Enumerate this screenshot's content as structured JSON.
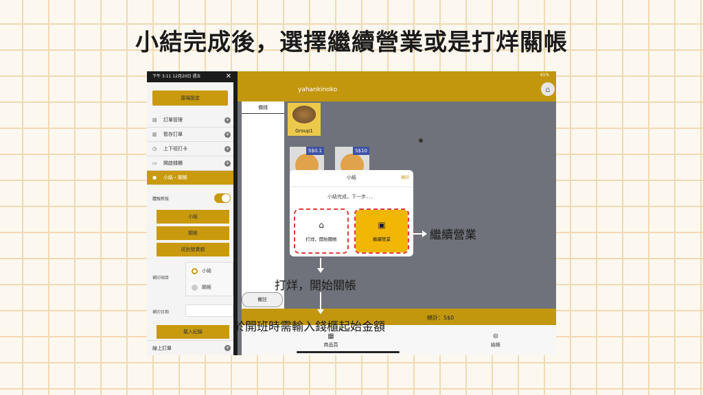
{
  "slide": {
    "title": "小結完成後，選擇繼續營業或是打烊關帳"
  },
  "status_bar": {
    "time_date": "下午 3:11  12月20日 週五",
    "battery": "41%"
  },
  "app": {
    "title": "yahankinoko"
  },
  "drawer": {
    "remote_settings": "遠端設定",
    "menu_items": [
      {
        "label": "訂單管理",
        "icon": "inbox-icon"
      },
      {
        "label": "暫存訂單",
        "icon": "clipboard-icon"
      },
      {
        "label": "上下班打卡",
        "icon": "clock-icon"
      },
      {
        "label": "開啟錢櫃",
        "icon": "drawer-icon"
      }
    ],
    "active_item": "小結・關帳",
    "toggle_label": "體驗新版",
    "sub_buttons": [
      "小結",
      "關帳",
      "班別營業額"
    ],
    "print_label": "補印項目",
    "print_options": [
      {
        "label": "小結",
        "selected": true
      },
      {
        "label": "關帳",
        "selected": false
      }
    ],
    "date_label": "補印日期",
    "record_button": "載入紀錄",
    "bottom_item": "線上訂單"
  },
  "main": {
    "price_header": "價錢",
    "group_label": "Group1",
    "products": [
      {
        "price": "S$0.1"
      },
      {
        "price": "S$10"
      }
    ],
    "note_button": "備註",
    "total": "總計：S$0",
    "tabs": [
      "商品頁",
      "結帳"
    ]
  },
  "modal": {
    "title": "小結",
    "close_label": "補印",
    "subtitle": "小結完成，下一步．．．",
    "option_close": "打烊，開始關帳",
    "option_continue": "繼續營業"
  },
  "annotations": {
    "continue": "繼續營業",
    "close": "打烊，開始關帳",
    "cash_note": "於開班時需輸入錢櫃起始金額"
  }
}
